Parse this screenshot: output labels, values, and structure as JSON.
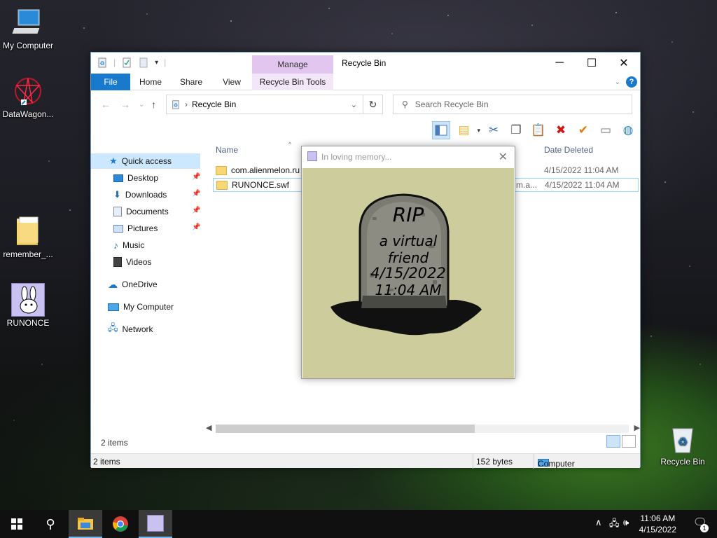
{
  "desktop": {
    "icons": [
      {
        "label": "My Computer"
      },
      {
        "label": "DataWagon..."
      },
      {
        "label": "remember_..."
      },
      {
        "label": "RUNONCE"
      },
      {
        "label": "Recycle Bin"
      }
    ]
  },
  "window": {
    "title": "Recycle Bin",
    "manage_tab": "Manage",
    "tabs": {
      "file": "File",
      "home": "Home",
      "share": "Share",
      "view": "View",
      "tools": "Recycle Bin Tools"
    },
    "address": "Recycle Bin",
    "search_placeholder": "Search Recycle Bin",
    "nav": {
      "quick_access": "Quick access",
      "desktop": "Desktop",
      "downloads": "Downloads",
      "documents": "Documents",
      "pictures": "Pictures",
      "music": "Music",
      "videos": "Videos",
      "onedrive": "OneDrive",
      "my_computer": "My Computer",
      "network": "Network"
    },
    "columns": {
      "name": "Name",
      "date_deleted": "Date Deleted"
    },
    "files": [
      {
        "name": "com.alienmelon.ru",
        "trail": "",
        "date": "4/15/2022 11:04 AM"
      },
      {
        "name": "RUNONCE.swf",
        "trail": "m.a...",
        "date": "4/15/2022 11:04 AM"
      }
    ],
    "status_items": "2 items",
    "outer_status": {
      "items": "2 items",
      "size": "152 bytes",
      "location": "Computer"
    }
  },
  "popup": {
    "title": "In loving memory...",
    "rip": "RIP",
    "line1": "a virtual",
    "line2": "friend",
    "date": "4/15/2022",
    "time": "11:04 AM"
  },
  "taskbar": {
    "time": "11:06 AM",
    "date": "4/15/2022",
    "notification_count": "1"
  },
  "colors": {
    "accent": "#1979ca",
    "manage": "#e3c6f0",
    "popup_bg": "#cccc9c"
  }
}
